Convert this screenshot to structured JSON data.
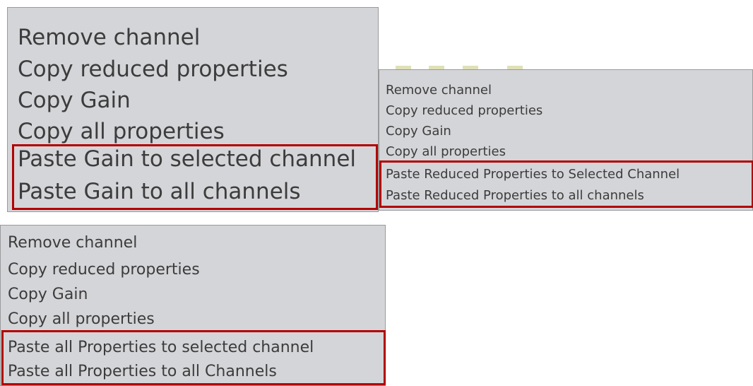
{
  "menus": [
    {
      "items": [
        {
          "label": "Remove channel"
        },
        {
          "label": "Copy reduced properties"
        },
        {
          "label": "Copy Gain"
        },
        {
          "label": "Copy all properties"
        },
        {
          "label": "Paste Gain to selected channel"
        },
        {
          "label": "Paste Gain to all channels"
        }
      ],
      "highlight_color": "#b20000",
      "background_color": "#d4d5d8"
    },
    {
      "items": [
        {
          "label": "Remove channel"
        },
        {
          "label": "Copy reduced properties"
        },
        {
          "label": "Copy Gain"
        },
        {
          "label": "Copy all properties"
        },
        {
          "label": "Paste Reduced Properties to Selected Channel"
        },
        {
          "label": "Paste Reduced Properties to all channels"
        }
      ],
      "highlight_color": "#b20000",
      "background_color": "#d4d5d8"
    },
    {
      "items": [
        {
          "label": "Remove channel"
        },
        {
          "label": "Copy reduced properties"
        },
        {
          "label": "Copy Gain"
        },
        {
          "label": "Copy all properties"
        },
        {
          "label": "Paste all Properties to selected channel"
        },
        {
          "label": "Paste all Properties to all Channels"
        }
      ],
      "highlight_color": "#b20000",
      "background_color": "#d4d5d8"
    }
  ]
}
